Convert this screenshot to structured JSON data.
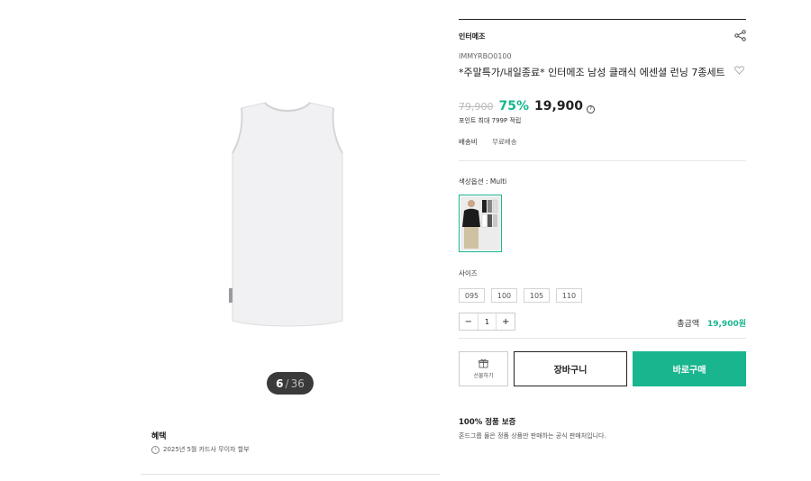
{
  "gallery": {
    "counter_current": "6",
    "counter_separator": "/",
    "counter_total": "36",
    "benefit_title": "혜택",
    "benefit_text": "2025년 5월 카드사 무이자 할부"
  },
  "product": {
    "brand": "인터메조",
    "code": "IMMYRBO0100",
    "title": "*주말특가/내일종료* 인터메조 남성 클래식 에센셜 런닝 7종세트",
    "price_original": "79,900",
    "discount": "75%",
    "price_final": "19,900",
    "points": "포인트 최대 799P 적립",
    "shipping_label": "배송비",
    "shipping_value": "무료배송",
    "color_label": "색상옵션 : Multi",
    "size_label": "사이즈",
    "sizes": [
      "095",
      "100",
      "105",
      "110"
    ],
    "quantity": "1",
    "minus": "−",
    "plus": "+",
    "total_label": "총금액",
    "total_amount": "19,900원",
    "gift_label": "선물하기",
    "cart_label": "장바구니",
    "buy_label": "바로구매",
    "auth_title": "100% 정품 보증",
    "auth_desc": "혼드그룹 몰은 정품 상품만 판매하는 공식 판매처입니다."
  },
  "colors": {
    "accent": "#19b58f",
    "counter_bg": "#3a3a3a"
  },
  "icons": [
    "share-icon",
    "heart-icon",
    "help-icon",
    "info-icon",
    "gift-icon"
  ]
}
